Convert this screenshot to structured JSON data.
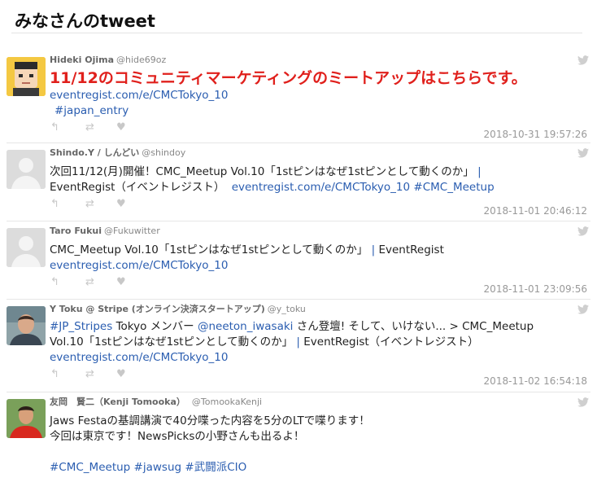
{
  "header": {
    "title": "みなさんのtweet"
  },
  "tweets": [
    {
      "name": "Hideki Ojima",
      "handle": "@hide69oz",
      "lines": [
        "11/12のコミュニティマーケティングのミートアップはこちらです。"
      ],
      "link": "eventregist.com/e/CMCTokyo_10",
      "hashtag": "#japan_entry",
      "time": "2018-10-31 19:57:26"
    },
    {
      "name": "Shindo.Y / しんどい",
      "handle": "@shindoy",
      "line1_text": "次回11/12(月)開催！CMC_Meetup Vol.10「1stピンはなぜ1stピンとして動くのか」",
      "line1_pipe": "|",
      "line2_text": "EventRegist（イベントレジスト）",
      "link": "eventregist.com/e/CMCTokyo_10",
      "hashtag": "#CMC_Meetup",
      "time": "2018-11-01 20:46:12"
    },
    {
      "name": "Taro Fukui",
      "handle": "@Fukuwitter",
      "line1_text": "CMC_Meetup Vol.10「1stピンはなぜ1stピンとして動くのか」",
      "line1_pipe": "|",
      "line1_tail": "EventRegist",
      "link": "eventregist.com/e/CMCTokyo_10",
      "time": "2018-11-01 23:09:56"
    },
    {
      "name": "Y Toku @ Stripe (オンライン決済スタートアップ)",
      "handle": "@y_toku",
      "hashtag": "#JP_Stripes",
      "line1_a": "Tokyo メンバー",
      "mention": "@neeton_iwasaki",
      "line1_b": "さん登壇! そして、いけない... >  CMC_Meetup",
      "line2_text": "Vol.10「1stピンはなぜ1stピンとして動くのか」",
      "line2_pipe": "|",
      "line2_tail": "EventRegist（イベントレジスト）",
      "link": "eventregist.com/e/CMCTokyo_10",
      "time": "2018-11-02 16:54:18"
    },
    {
      "name": "友岡　賢二（Kenji Tomooka）",
      "handle": "@TomookaKenji",
      "line1": "Jaws Festaの基調講演で40分喋った内容を5分のLTで喋ります！",
      "line2": "今回は東京です！NewsPicksの小野さんも出るよ！",
      "hashtags": [
        "#CMC_Meetup",
        "#jawsug",
        "#武闘派CIO"
      ]
    }
  ],
  "icons": {
    "reply": "reply-icon",
    "retweet": "retweet-icon",
    "like": "heart-icon",
    "brand": "twitter-bird-icon"
  },
  "colors": {
    "link": "#2a5db0",
    "highlight": "#e0201c",
    "muted": "#999999"
  }
}
